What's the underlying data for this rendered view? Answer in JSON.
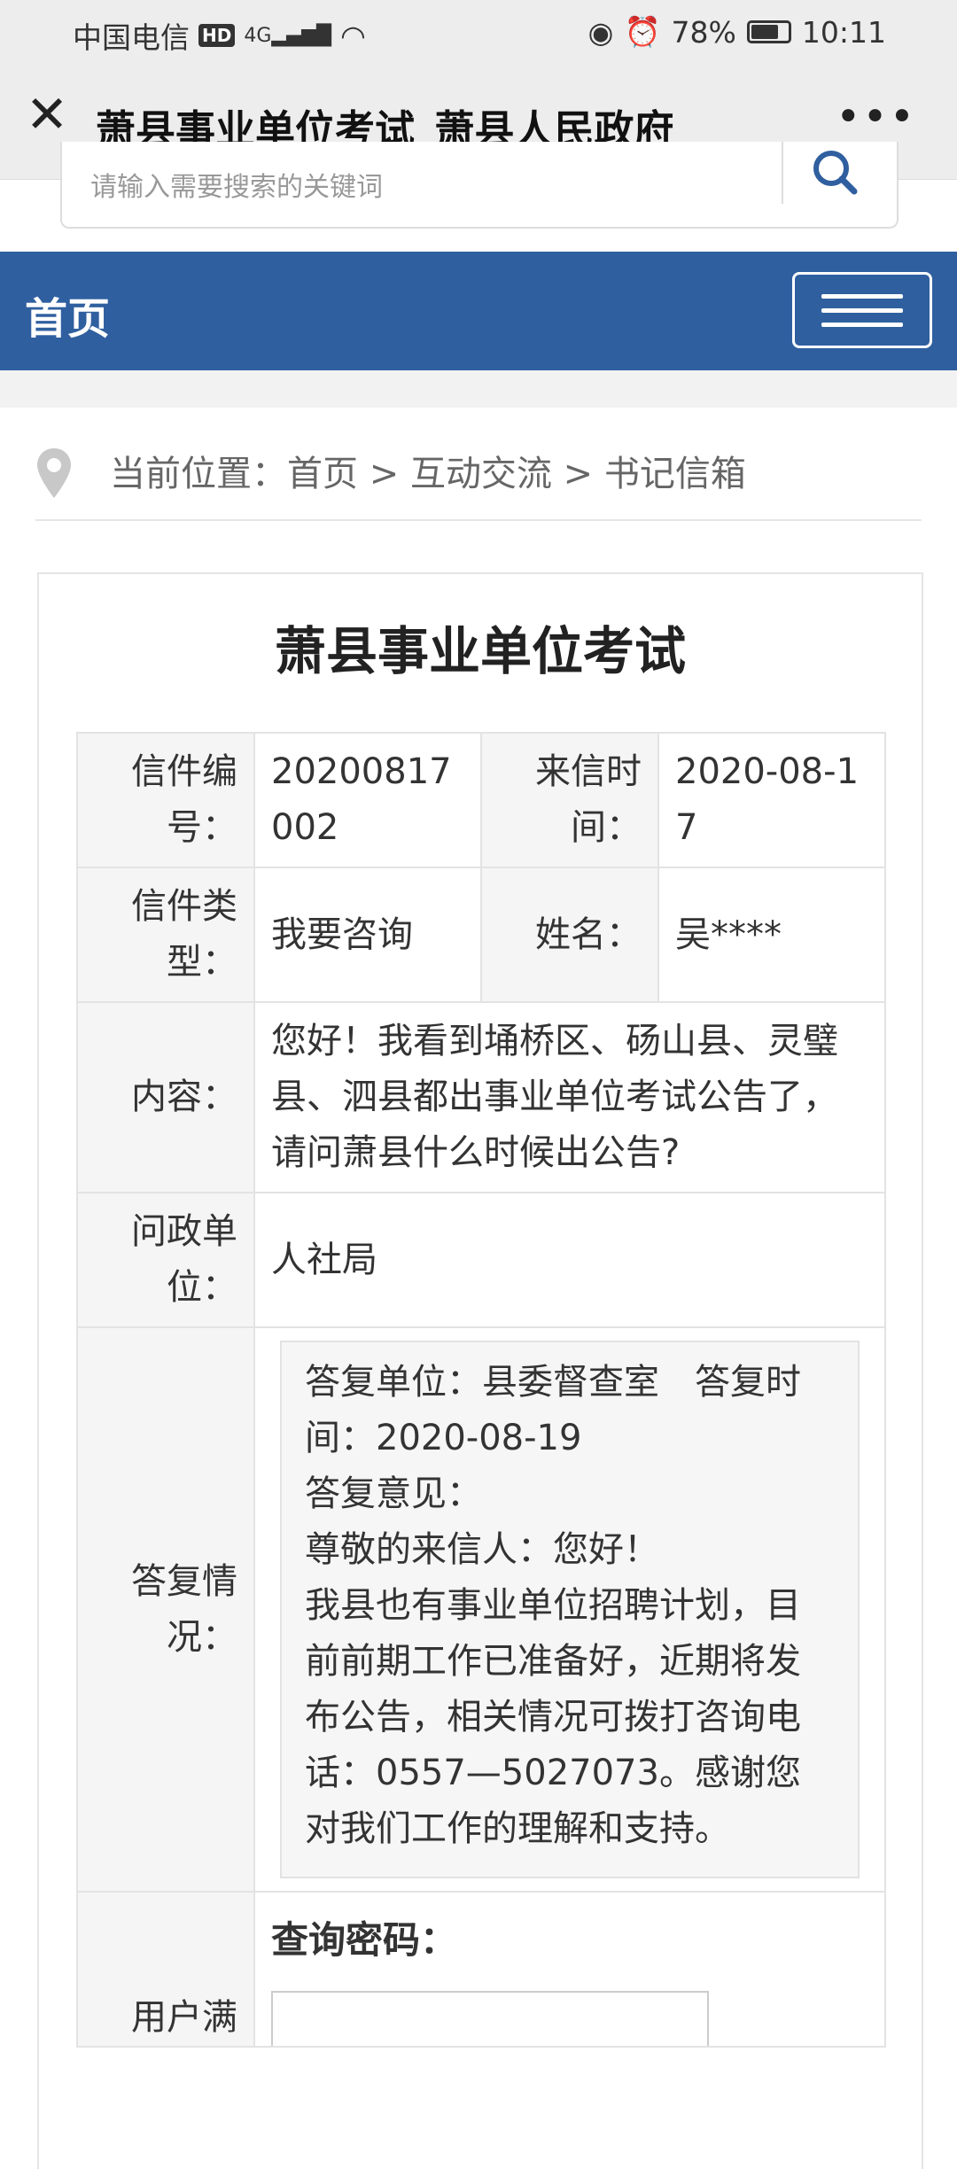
{
  "status": {
    "carrier": "中国电信",
    "hd": "HD",
    "network": "4G",
    "battery": "78%",
    "time": "10:11"
  },
  "titlebar": {
    "title": "萧县事业单位考试_萧县人民政府",
    "close_icon": "close-icon",
    "more_icon": "more-icon"
  },
  "search": {
    "placeholder": "请输入需要搜索的关键词"
  },
  "nav": {
    "home": "首页"
  },
  "breadcrumb": {
    "text": "当前位置：首页 > 互动交流 > 书记信箱"
  },
  "article": {
    "title": "萧县事业单位考试",
    "labels": {
      "letter_no": "信件编号：",
      "letter_time": "来信时间：",
      "letter_type": "信件类型：",
      "name": "姓名：",
      "content": "内容：",
      "unit": "问政单位：",
      "reply": "答复情况：",
      "user_eval": "用户满"
    },
    "values": {
      "letter_no": "20200817002",
      "letter_time": "2020-08-17",
      "letter_type": "我要咨询",
      "name": "吴****",
      "content": "您好！我看到埇桥区、砀山县、灵璧县、泗县都出事业单位考试公告了，请问萧县什么时候出公告?",
      "unit": "人社局"
    },
    "reply": {
      "line1": "答复单位：县委督查室　答复时间：2020-08-19",
      "line2": "答复意见：",
      "line3": "尊敬的来信人：您好！",
      "line4": "我县也有事业单位招聘计划，目前前期工作已准备好，近期将发布公告，相关情况可拨打咨询电话：0557—5027073。感谢您对我们工作的理解和支持。"
    },
    "query_password": "查询密码："
  }
}
